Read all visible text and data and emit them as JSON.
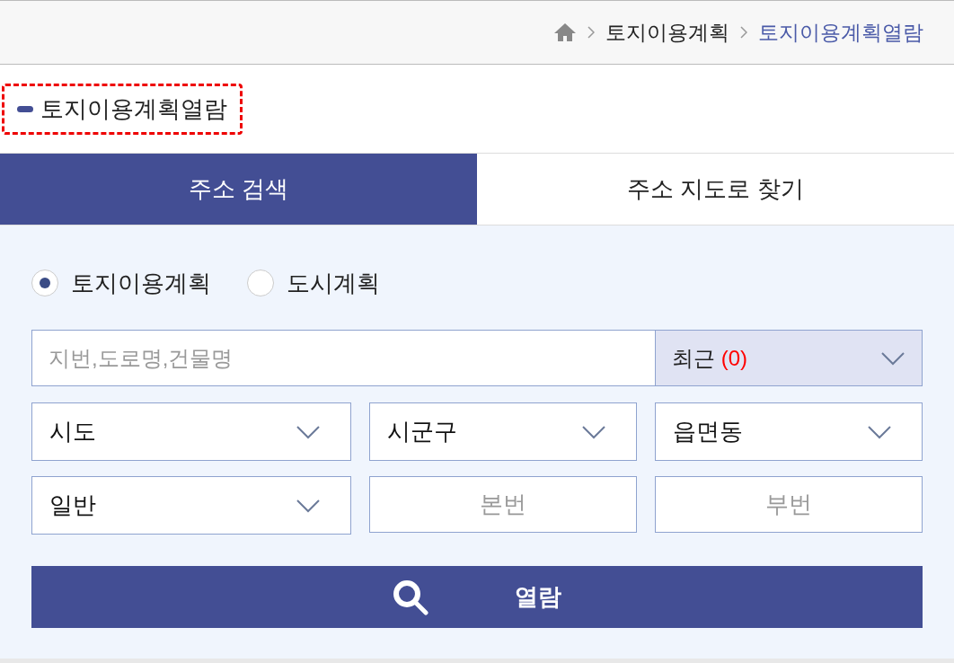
{
  "breadcrumb": [
    {
      "label": "토지이용계획",
      "current": false
    },
    {
      "label": "토지이용계획열람",
      "current": true
    }
  ],
  "page_title": "토지이용계획열람",
  "tabs": [
    {
      "label": "주소 검색",
      "selected": true
    },
    {
      "label": "주소 지도로 찾기",
      "selected": false
    }
  ],
  "plan_type": [
    {
      "label": "토지이용계획",
      "selected": true
    },
    {
      "label": "도시계획",
      "selected": false
    }
  ],
  "search": {
    "placeholder": "지번,도로명,건물명",
    "recent_label": "최근",
    "recent_count": "(0)"
  },
  "selects": [
    {
      "kind": "dropdown",
      "value": "시도"
    },
    {
      "kind": "dropdown",
      "value": "시군구"
    },
    {
      "kind": "dropdown",
      "value": "읍면동"
    },
    {
      "kind": "dropdown",
      "value": "일반"
    },
    {
      "kind": "input",
      "placeholder": "본번"
    },
    {
      "kind": "input",
      "placeholder": "부번"
    }
  ],
  "submit": "열람"
}
